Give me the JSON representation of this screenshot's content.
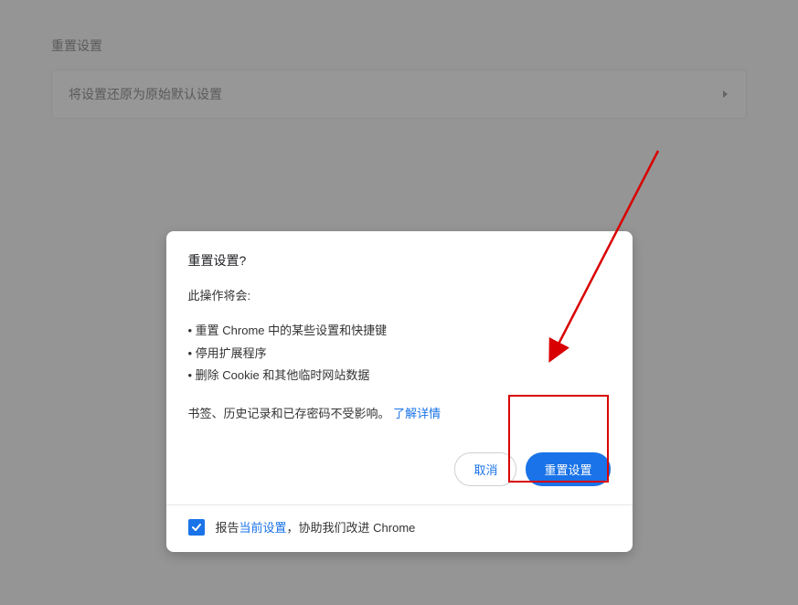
{
  "section": {
    "title": "重置设置",
    "row_label": "将设置还原为原始默认设置"
  },
  "dialog": {
    "title": "重置设置?",
    "intro": "此操作将会:",
    "bullets": [
      "重置 Chrome 中的某些设置和快捷键",
      "停用扩展程序",
      "删除 Cookie 和其他临时网站数据"
    ],
    "note_prefix": "书签、历史记录和已存密码不受影响。",
    "learn_more": "了解详情",
    "cancel": "取消",
    "confirm": "重置设置",
    "footer_prefix": "报告",
    "footer_link": "当前设置",
    "footer_suffix": "，协助我们改进 Chrome"
  }
}
